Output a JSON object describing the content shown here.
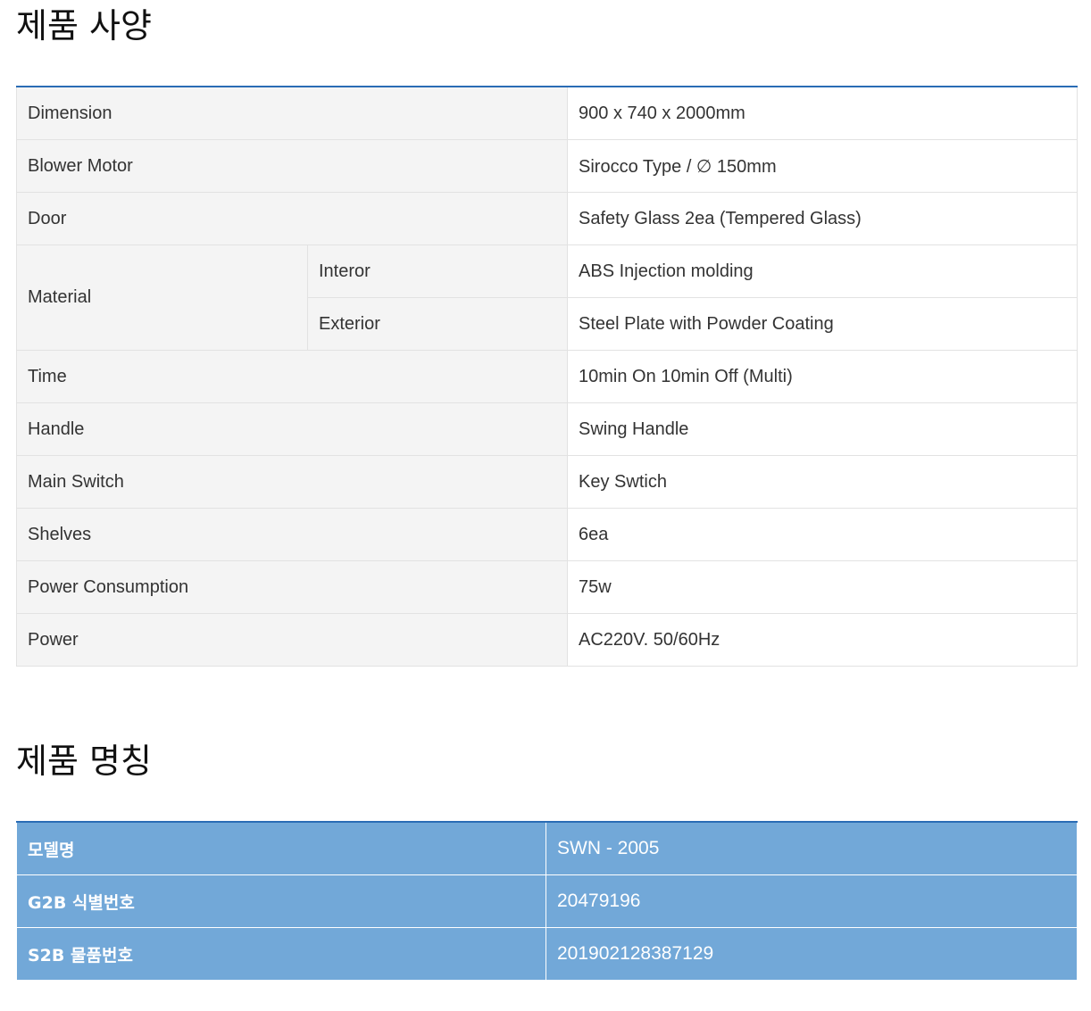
{
  "spec_section": {
    "title": "제품 사양",
    "rows": [
      {
        "label": "Dimension",
        "value": "900 x 740 x 2000mm"
      },
      {
        "label": "Blower Motor",
        "value": "Sirocco Type / ∅ 150mm"
      },
      {
        "label": "Door",
        "value": "Safety Glass 2ea (Tempered Glass)"
      },
      {
        "label": "Material",
        "sub": [
          {
            "label": "Interor",
            "value": "ABS Injection molding"
          },
          {
            "label": "Exterior",
            "value": "Steel Plate with Powder Coating"
          }
        ]
      },
      {
        "label": "Time",
        "value": "10min On 10min Off (Multi)"
      },
      {
        "label": "Handle",
        "value": "Swing Handle"
      },
      {
        "label": "Main Switch",
        "value": "Key Swtich"
      },
      {
        "label": "Shelves",
        "value": "6ea"
      },
      {
        "label": "Power Consumption",
        "value": "75w"
      },
      {
        "label": "Power",
        "value": "AC220V. 50/60Hz"
      }
    ]
  },
  "name_section": {
    "title": "제품 명칭",
    "rows": [
      {
        "label": "모델명",
        "value": "SWN - 2005"
      },
      {
        "label": "G2B 식별번호",
        "value": "20479196"
      },
      {
        "label": "S2B 물품번호",
        "value": "201902128387129"
      }
    ]
  },
  "colors": {
    "accent_line": "#2a6cb5",
    "name_table_bg": "#72a8d8",
    "label_bg": "#f4f4f4"
  }
}
